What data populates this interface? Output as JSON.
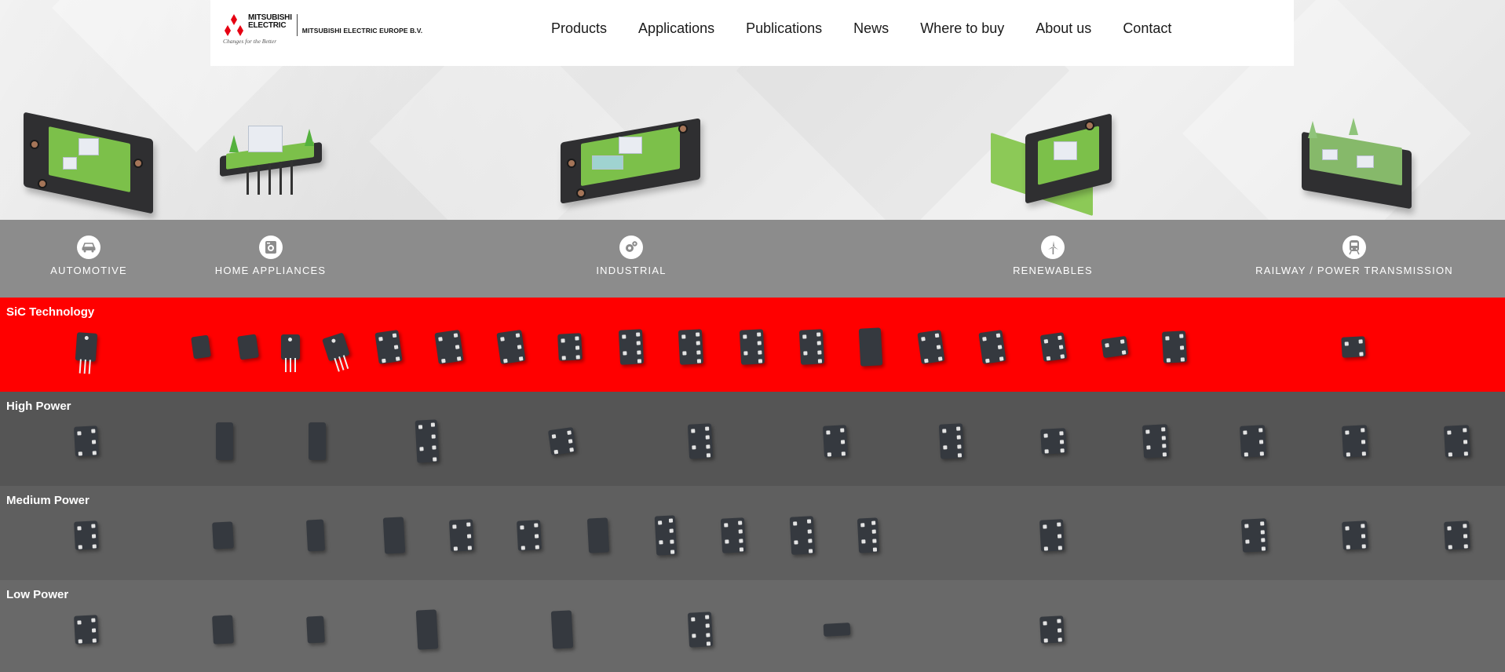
{
  "header": {
    "logo_brand_line1": "MITSUBISHI",
    "logo_brand_line2": "ELECTRIC",
    "logo_tagline": "Changes for the Better",
    "logo_subsidiary": "MITSUBISHI  ELECTRIC EUROPE B.V.",
    "nav": [
      {
        "label": "Products"
      },
      {
        "label": "Applications"
      },
      {
        "label": "Publications"
      },
      {
        "label": "News"
      },
      {
        "label": "Where to buy"
      },
      {
        "label": "About us"
      },
      {
        "label": "Contact"
      }
    ]
  },
  "applications": [
    {
      "label": "AUTOMOTIVE",
      "icon": "car-icon"
    },
    {
      "label": "HOME APPLIANCES",
      "icon": "washing-machine-icon"
    },
    {
      "label": "INDUSTRIAL",
      "icon": "gears-icon"
    },
    {
      "label": "RENEWABLES",
      "icon": "wind-turbine-icon"
    },
    {
      "label": "RAILWAY / POWER TRANSMISSION",
      "icon": "train-icon"
    }
  ],
  "product_rows": [
    {
      "title": "SiC Technology",
      "color": "#ff0000"
    },
    {
      "title": "High Power",
      "color": "#555555"
    },
    {
      "title": "Medium Power",
      "color": "#5f5f5f"
    },
    {
      "title": "Low Power",
      "color": "#696969"
    }
  ],
  "colors": {
    "brand_red": "#e60012",
    "sic_row": "#ff0000",
    "app_band": "#8c8c8c"
  }
}
